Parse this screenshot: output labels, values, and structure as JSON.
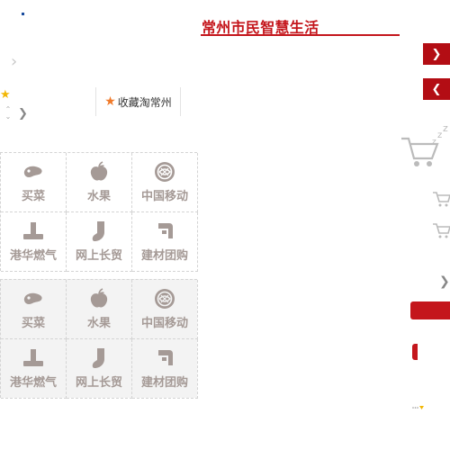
{
  "header": {
    "title": "常州市民智慧生活"
  },
  "favorite": {
    "label": "收藏淘常州"
  },
  "services_primary": [
    {
      "label": "买菜",
      "icon": "meat-icon"
    },
    {
      "label": "水果",
      "icon": "apple-icon"
    },
    {
      "label": "中国移动",
      "icon": "china-mobile-icon"
    },
    {
      "label": "港华燃气",
      "icon": "gas-pipe-icon"
    },
    {
      "label": "网上长贸",
      "icon": "boot-icon"
    },
    {
      "label": "建材团购",
      "icon": "faucet-icon"
    }
  ],
  "services_secondary": [
    {
      "label": "买菜",
      "icon": "meat-icon"
    },
    {
      "label": "水果",
      "icon": "apple-icon"
    },
    {
      "label": "中国移动",
      "icon": "china-mobile-icon"
    },
    {
      "label": "港华燃气",
      "icon": "gas-pipe-icon"
    },
    {
      "label": "网上长贸",
      "icon": "boot-icon"
    },
    {
      "label": "建材团购",
      "icon": "faucet-icon"
    }
  ],
  "colors": {
    "accent": "#c4161c",
    "dark_red": "#b30d14",
    "icon_gray": "#a59a96",
    "star_orange": "#f07a2a",
    "star_yellow": "#f2b705"
  }
}
